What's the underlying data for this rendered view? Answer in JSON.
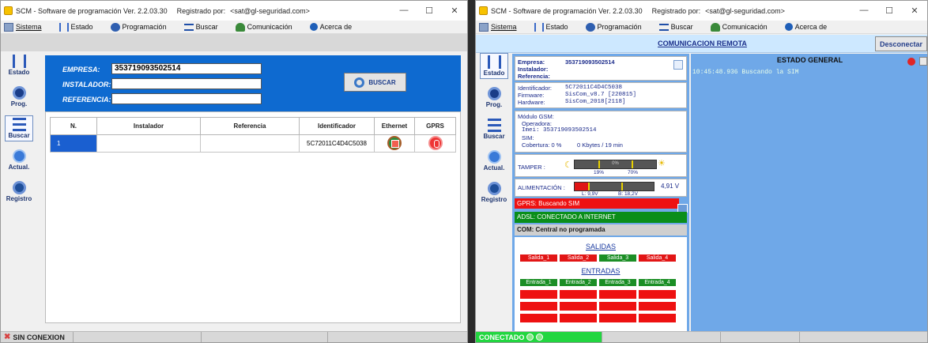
{
  "left": {
    "title": {
      "app": "SCM - Software de programación Ver. 2.2.03.30",
      "reg": "Registrado por:",
      "email": "<sat@gl-seguridad.com>"
    },
    "menu": {
      "sistema": "Sistema",
      "estado": "Estado",
      "programacion": "Programación",
      "buscar": "Buscar",
      "comunicacion": "Comunicación",
      "acerca": "Acerca de"
    },
    "sidebar": {
      "estado": "Estado",
      "prog": "Prog.",
      "buscar": "Buscar",
      "actual": "Actual.",
      "registro": "Registro"
    },
    "form": {
      "empresa_label": "EMPRESA:",
      "empresa_value": "353719093502514",
      "instalador_label": "INSTALADOR:",
      "instalador_value": "",
      "referencia_label": "REFERENCIA:",
      "referencia_value": "",
      "buscar": "BUSCAR"
    },
    "table": {
      "headers": {
        "n": "N.",
        "instalador": "Instalador",
        "referencia": "Referencia",
        "identificador": "Identificador",
        "ethernet": "Ethernet",
        "gprs": "GPRS"
      },
      "row": {
        "n": "1",
        "instalador": "",
        "referencia": "",
        "identificador": "5C72011C4D4C5038",
        "ethernet_icon": "ethernet-icon",
        "gprs_icon": "gprs-icon"
      }
    },
    "status": "SIN CONEXION"
  },
  "right": {
    "title": {
      "app": "SCM - Software de programación Ver. 2.2.03.30",
      "reg": "Registrado por:",
      "email": "<sat@gl-seguridad.com>"
    },
    "menu": {
      "sistema": "Sistema",
      "estado": "Estado",
      "programacion": "Programación",
      "buscar": "Buscar",
      "comunicacion": "Comunicación",
      "acerca": "Acerca de"
    },
    "sidebar": {
      "estado": "Estado",
      "prog": "Prog.",
      "buscar": "Buscar",
      "actual": "Actual.",
      "registro": "Registro"
    },
    "remote": {
      "title": "COMUNICACION REMOTA",
      "disconnect": "Desconectar"
    },
    "info": {
      "empresa_label": "Empresa:",
      "empresa_value": "353719093502514",
      "instalador_label": "Instalador:",
      "referencia_label": "Referencia:"
    },
    "device": {
      "id_label": "Identificador:",
      "id_value": "5C72011C4D4C5038",
      "fw_label": "Firmware:",
      "fw_value": "SisCom_v8.7 [220815]",
      "hw_label": "Hardware:",
      "hw_value": "SisCom_2018[2118]"
    },
    "gsm": {
      "title": "Módulo GSM:",
      "operadora": "Operadora:",
      "imei": "Imei: 353719093502514",
      "sim": "SIM:",
      "cobertura": "Cobertura:  0 %",
      "kbytes": "0 Kbytes / 19 min"
    },
    "tamper": {
      "label": "TAMPER :",
      "pct": "0%",
      "low": "19%",
      "high": "70%"
    },
    "alim": {
      "label": "ALIMENTACIÓN :",
      "value": "4,91 V",
      "l": "L: 9,9V",
      "b": "B: 18,2V"
    },
    "gprs": "GPRS: Buscando SIM",
    "adsl": "ADSL: CONECTADO A INTERNET",
    "com": "COM: Central no programada",
    "salidas": {
      "title": "SALIDAS",
      "items": [
        "Salida_1",
        "Salida_2",
        "Salida_3",
        "Salida_4"
      ]
    },
    "entradas": {
      "title": "ENTRADAS",
      "items": [
        "Entrada_1",
        "Entrada_2",
        "Entrada_3",
        "Entrada_4"
      ]
    },
    "estado": {
      "title": "ESTADO GENERAL",
      "log": "10:45:48.936 Buscando la SIM"
    },
    "status": "CONECTADO"
  },
  "colors": {
    "blue_panel": "#0e6ad0",
    "remote_panel": "#6fa8e8",
    "red": "#ee1111",
    "green": "#0a8e1a",
    "status_green": "#22d640"
  }
}
